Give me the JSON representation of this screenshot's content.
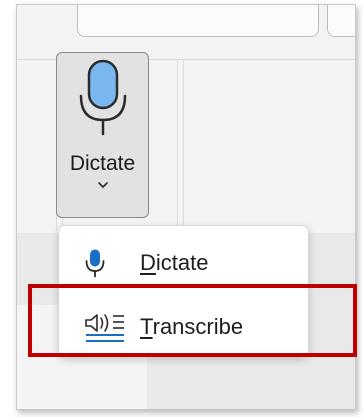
{
  "dictate_button": {
    "label": "Dictate",
    "icon": "microphone-icon",
    "dropdown_icon": "chevron-down-icon"
  },
  "menu": {
    "items": [
      {
        "label_first": "D",
        "label_rest": "ictate",
        "icon": "microphone-icon"
      },
      {
        "label_first": "T",
        "label_rest": "ranscribe",
        "icon": "transcribe-icon"
      }
    ]
  },
  "colors": {
    "mic_fill": "#7ab7f0",
    "icon_blue": "#1a6fc4",
    "highlight_border": "#c00000"
  }
}
